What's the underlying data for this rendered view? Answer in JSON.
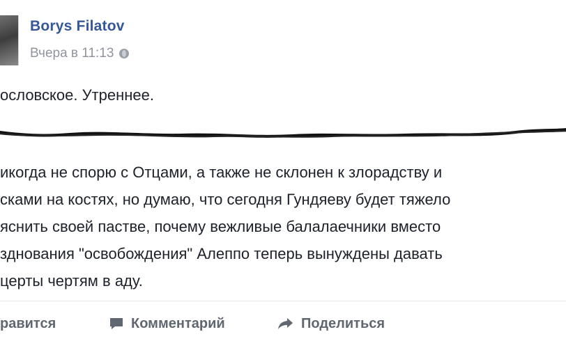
{
  "post": {
    "author": "Borys Filatov",
    "timestamp": "Вчера в 11:13",
    "privacy_icon": "globe-icon",
    "intro": "осло​вское. Утреннее.",
    "body_lines": [
      "икогда не спорю с Отцами, а также не склонен к злорадству и",
      "сками на костях, но думаю, что сегодня Гундяеву будет тяжело",
      "яснить своей пастве, почему вежливые балалаечники вместо",
      "здно​вания \"освобождения\" Алеппо теперь вынуждены давать",
      "церты чертям в аду."
    ]
  },
  "actions": {
    "like_label": "равится",
    "comment_label": "Комментарий",
    "share_label": "Поделиться"
  },
  "colors": {
    "author": "#365899",
    "meta": "#90949c",
    "action": "#606770",
    "text": "#1d2129"
  }
}
